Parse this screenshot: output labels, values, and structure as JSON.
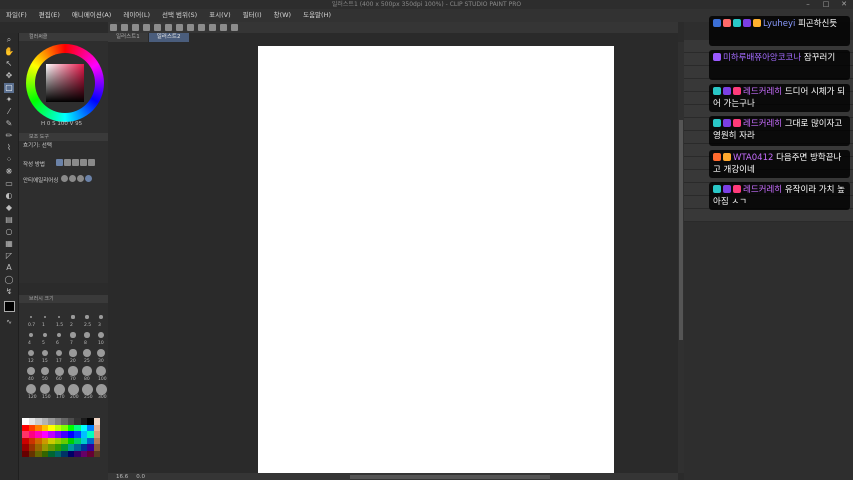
{
  "titlebar": {
    "title": "일러스트1 (400 x 500px 350dpi 100%) - CLIP STUDIO PAINT PRO",
    "min": "–",
    "max": "□",
    "close": "✕"
  },
  "menu": [
    "파일(F)",
    "편집(E)",
    "애니메이션(A)",
    "레이어(L)",
    "선택 범위(S)",
    "표시(V)",
    "필터(I)",
    "창(W)",
    "도움말(H)"
  ],
  "doc_tabs": [
    "일러스트1",
    "일러스트2"
  ],
  "color_panel": {
    "title": "컬러써클",
    "hsv_readout": "H 0  S 100  V 95",
    "h": 355,
    "s": 85,
    "v": 90
  },
  "subtool_panel": {
    "title": "보조 도구",
    "tool_name": "흐기기: 선택",
    "mode_label": "작성 방법",
    "interp_label": "안티에일리어싱"
  },
  "brush_panel": {
    "title": "브러시 크기",
    "sizes": [
      "0.7",
      "1",
      "1.5",
      "2",
      "2.5",
      "3",
      "4",
      "5",
      "6",
      "7",
      "8",
      "10",
      "12",
      "15",
      "17",
      "20",
      "25",
      "30",
      "40",
      "50",
      "60",
      "70",
      "80",
      "100",
      "120",
      "150",
      "170",
      "200",
      "250",
      "300"
    ]
  },
  "status": {
    "zoom": "16.6",
    "angle": "0.0"
  },
  "palette_colors": [
    "#ffffff",
    "#e6e6e6",
    "#cccccc",
    "#b3b3b3",
    "#999999",
    "#808080",
    "#666666",
    "#4d4d4d",
    "#333333",
    "#1a1a1a",
    "#000000",
    "#f2d8c8",
    "#ff0000",
    "#ff4000",
    "#ff8000",
    "#ffbf00",
    "#ffff00",
    "#bfff00",
    "#80ff00",
    "#00ff00",
    "#00ff80",
    "#00ffff",
    "#0080ff",
    "#e8b49a",
    "#ff3366",
    "#ff0080",
    "#ff00bf",
    "#ff00ff",
    "#bf00ff",
    "#8000ff",
    "#4000ff",
    "#0000ff",
    "#0040ff",
    "#00bfff",
    "#00ffbf",
    "#d49a7a",
    "#cc0000",
    "#cc3300",
    "#cc6600",
    "#cc9900",
    "#cccc00",
    "#99cc00",
    "#66cc00",
    "#00cc00",
    "#00cc66",
    "#00cccc",
    "#0066cc",
    "#b57a5a",
    "#990000",
    "#993300",
    "#996600",
    "#999900",
    "#669900",
    "#339900",
    "#009933",
    "#009999",
    "#006699",
    "#003399",
    "#330099",
    "#8a5a3a",
    "#660000",
    "#663300",
    "#666600",
    "#336600",
    "#006633",
    "#006666",
    "#003366",
    "#000066",
    "#330066",
    "#660066",
    "#660033",
    "#5a3a22"
  ],
  "chat": [
    {
      "user": "Lyuheyi",
      "user_color": "#8a9bff",
      "text": "피곤하신듯",
      "badge_colors": [
        "#3b6fd6",
        "#ff6a6a",
        "#29c7c7",
        "#7b3fe4",
        "#ffb02e"
      ]
    },
    {
      "user": "미하루배쮸아앙코코나",
      "user_color": "#a46cff",
      "text": "잠꾸러기",
      "badge_colors": [
        "#9b59ff"
      ]
    },
    {
      "user": "레드커레히",
      "user_color": "#c86eff",
      "text": "드디어 시체가 되어 가는구나",
      "badge_colors": [
        "#29c7c7",
        "#7b3fe4",
        "#ff3b7a"
      ]
    },
    {
      "user": "레드커레히",
      "user_color": "#c86eff",
      "text": "그대로 많이자고 영원히 자라",
      "badge_colors": [
        "#29c7c7",
        "#7b3fe4",
        "#ff3b7a"
      ]
    },
    {
      "user": "WTA0412",
      "user_color": "#c86eff",
      "text": "다음주면 방학끝나고 개강이네",
      "badge_colors": [
        "#ff6a2e",
        "#ffa82e"
      ]
    },
    {
      "user": "레드커레히",
      "user_color": "#c86eff",
      "text": "유작이라 가치 높아짐 ㅅㄱ",
      "badge_colors": [
        "#29c7c7",
        "#7b3fe4",
        "#ff3b7a"
      ]
    }
  ]
}
